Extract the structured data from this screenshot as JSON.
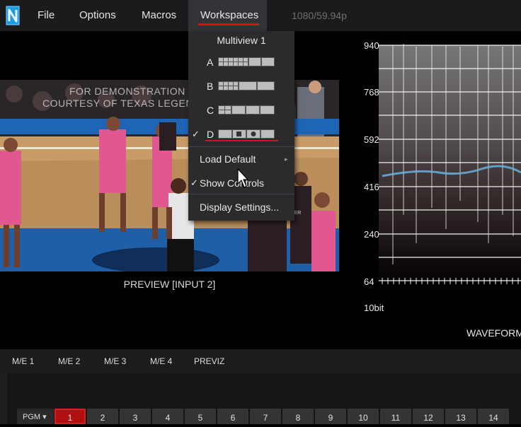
{
  "menubar": {
    "items": [
      {
        "label": "File"
      },
      {
        "label": "Options"
      },
      {
        "label": "Macros"
      },
      {
        "label": "Workspaces"
      }
    ],
    "format": "1080/59.94p"
  },
  "preview": {
    "label": "PREVIEW [INPUT 2]",
    "overlay_line1": "FOR DEMONSTRATION P",
    "overlay_line2": "COURTESY OF TEXAS LEGEND"
  },
  "waveform": {
    "ticks": [
      "940",
      "768",
      "592",
      "416",
      "240",
      "64"
    ],
    "bitdepth": "10bit",
    "title": "WAVEFORM"
  },
  "dropdown": {
    "title": "Multiview 1",
    "workspaces": [
      {
        "letter": "A",
        "icon": "layout-a-icon"
      },
      {
        "letter": "B",
        "icon": "layout-b-icon"
      },
      {
        "letter": "C",
        "icon": "layout-c-icon"
      },
      {
        "letter": "D",
        "icon": "layout-d-icon",
        "checked": true
      }
    ],
    "load_default": "Load Default",
    "show_controls": "Show Controls",
    "show_controls_checked": true,
    "display_settings": "Display Settings...",
    "check_mark": "✓",
    "submenu_arrow": "▸"
  },
  "me_tabs": [
    "M/E 1",
    "M/E 2",
    "M/E 3",
    "M/E 4",
    "PREVIZ"
  ],
  "pgm": {
    "label": "PGM ▾",
    "buttons": [
      "1",
      "2",
      "3",
      "4",
      "5",
      "6",
      "7",
      "8",
      "9",
      "10",
      "11",
      "12",
      "13",
      "14"
    ],
    "active": "1"
  },
  "colors": {
    "accent": "#d31515",
    "menu_bg": "#2b2b2e",
    "court_blue": "#1f5fa8",
    "jersey_pink": "#e0588f"
  }
}
